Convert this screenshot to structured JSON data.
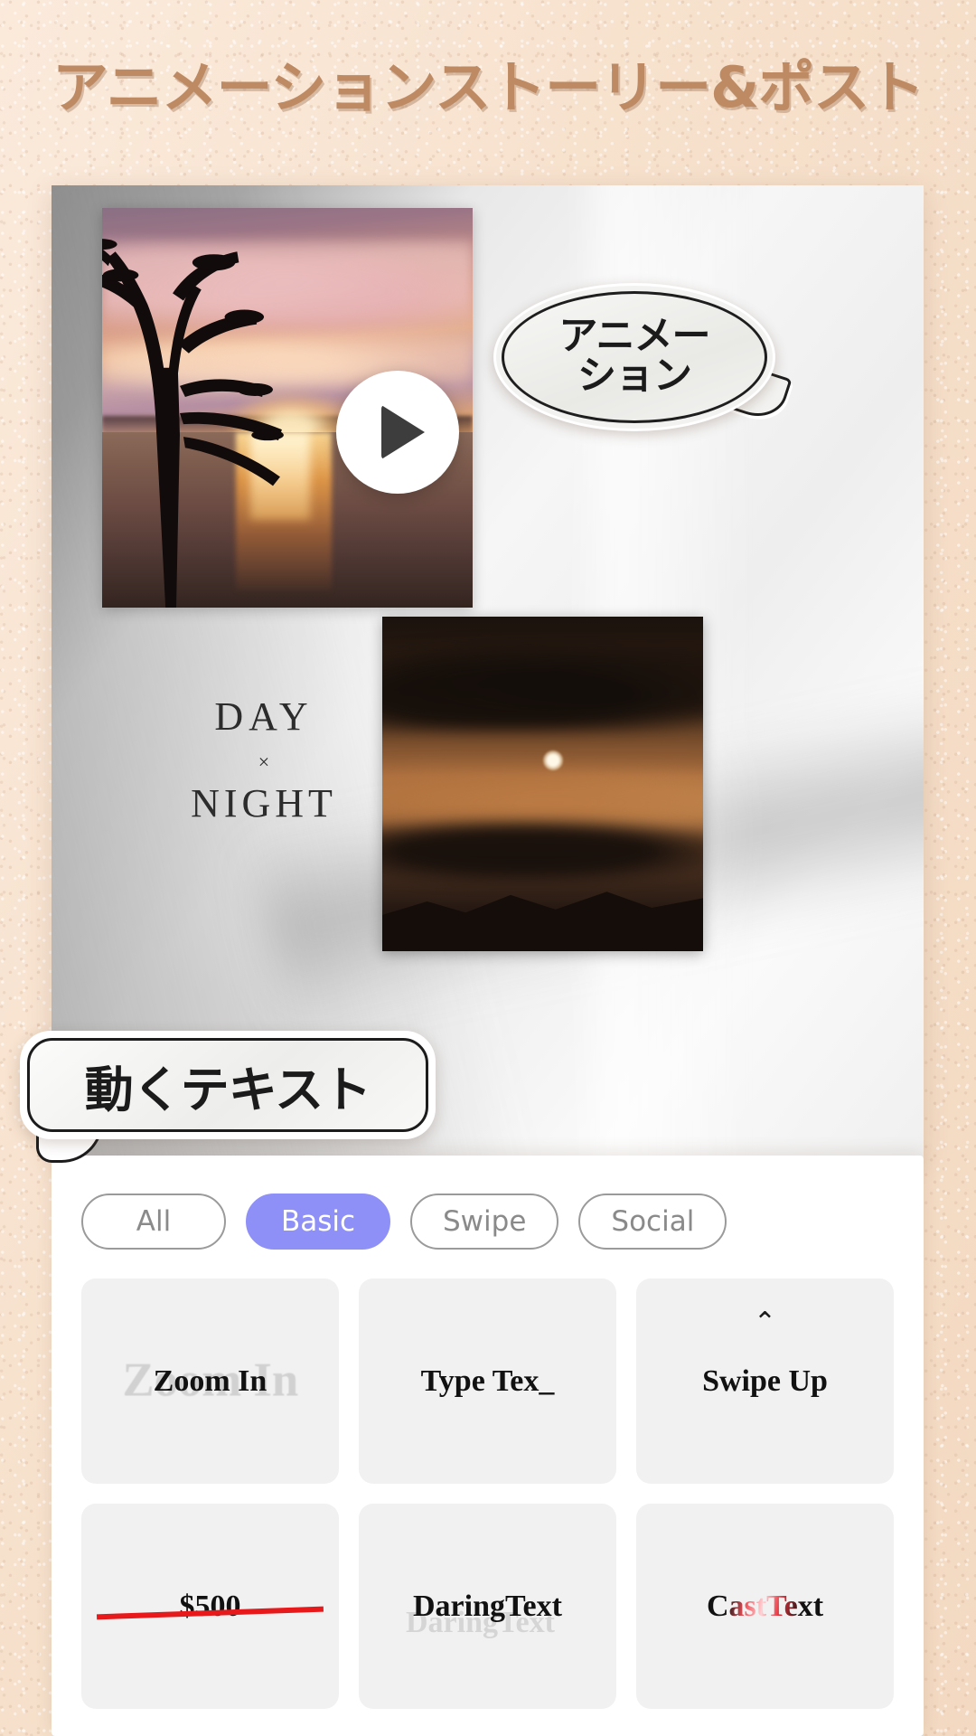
{
  "header": {
    "title": "アニメーションストーリー&ポスト",
    "color": "#bd8a63"
  },
  "preview": {
    "play_icon": "play-triangle-icon",
    "overlay_text": {
      "day": "DAY",
      "separator": "×",
      "night": "NIGHT"
    },
    "bubbles": [
      {
        "name": "animation-bubble",
        "line1": "アニメー",
        "line2": "ション"
      },
      {
        "name": "moving-text-bubble",
        "text": "動くテキスト"
      }
    ]
  },
  "sheet": {
    "tabs": [
      {
        "label": "All",
        "active": false
      },
      {
        "label": "Basic",
        "active": true
      },
      {
        "label": "Swipe",
        "active": false
      },
      {
        "label": "Social",
        "active": false
      }
    ],
    "active_tab_color": "#8f90f7",
    "presets": [
      {
        "label": "Zoom In",
        "ghost": "Zoom In",
        "style": "zoom"
      },
      {
        "label": "Type Tex_",
        "ghost": "",
        "style": "type"
      },
      {
        "label": "Swipe Up",
        "ghost": "",
        "style": "swipe",
        "icon": "chevron-up-icon",
        "icon_glyph": "⌃"
      },
      {
        "label": "$500",
        "ghost": "",
        "style": "strike"
      },
      {
        "label": "DaringText",
        "ghost": "DaringText",
        "style": "daring"
      },
      {
        "label": "CastText",
        "ghost": "",
        "style": "cast"
      }
    ]
  }
}
